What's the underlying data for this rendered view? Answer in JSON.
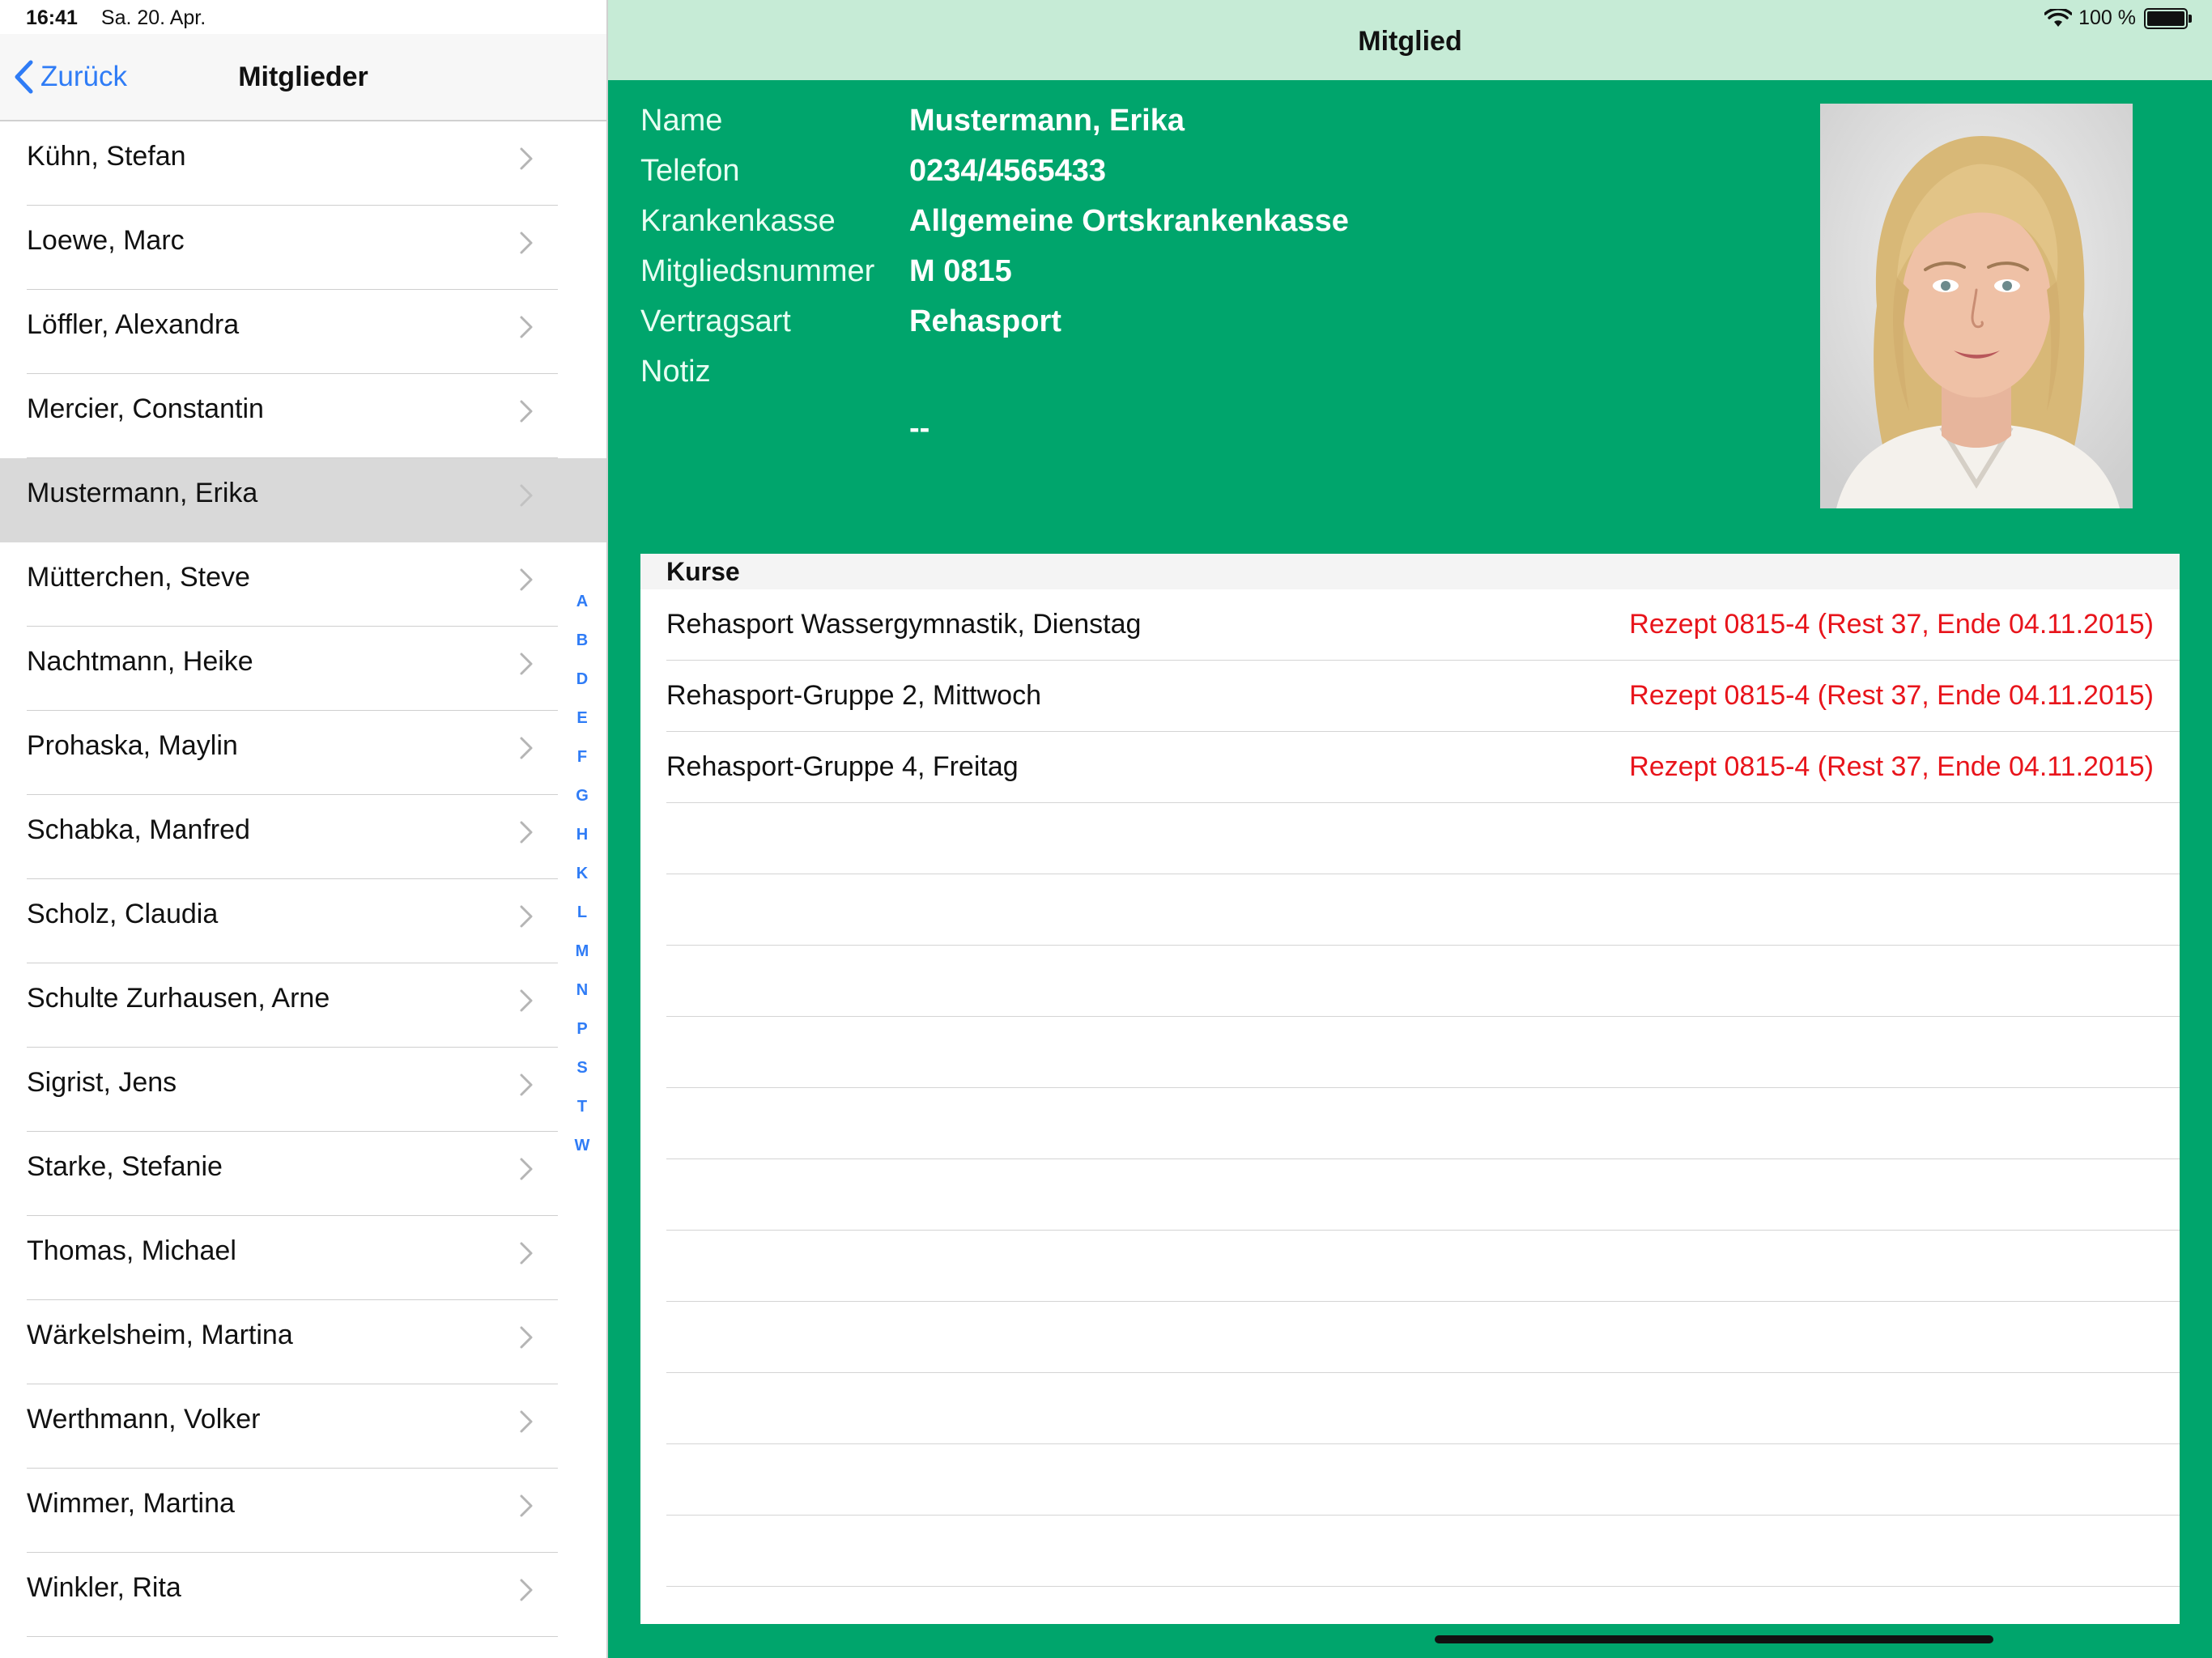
{
  "status": {
    "time": "16:41",
    "date": "Sa. 20. Apr.",
    "battery": "100 %",
    "wifi_icon": "wifi-icon",
    "battery_icon": "battery-icon"
  },
  "left_nav": {
    "back_label": "Zurück",
    "title": "Mitglieder"
  },
  "members": [
    {
      "name": "Kühn, Stefan"
    },
    {
      "name": "Loewe, Marc"
    },
    {
      "name": "Löffler, Alexandra"
    },
    {
      "name": "Mercier, Constantin"
    },
    {
      "name": "Mustermann, Erika",
      "selected": true
    },
    {
      "name": "Mütterchen, Steve"
    },
    {
      "name": "Nachtmann, Heike"
    },
    {
      "name": "Prohaska, Maylin"
    },
    {
      "name": "Schabka, Manfred"
    },
    {
      "name": "Scholz, Claudia"
    },
    {
      "name": "Schulte Zurhausen, Arne"
    },
    {
      "name": "Sigrist, Jens"
    },
    {
      "name": "Starke, Stefanie"
    },
    {
      "name": "Thomas, Michael"
    },
    {
      "name": "Wärkelsheim, Martina"
    },
    {
      "name": "Werthmann, Volker"
    },
    {
      "name": "Wimmer, Martina"
    },
    {
      "name": "Winkler, Rita"
    }
  ],
  "index_letters": [
    "A",
    "B",
    "D",
    "E",
    "F",
    "G",
    "H",
    "K",
    "L",
    "M",
    "N",
    "P",
    "S",
    "T",
    "W"
  ],
  "detail": {
    "title": "Mitglied",
    "fields": {
      "name_label": "Name",
      "name_value": "Mustermann, Erika",
      "phone_label": "Telefon",
      "phone_value": "0234/4565433",
      "insurance_label": "Krankenkasse",
      "insurance_value": "Allgemeine Ortskrankenkasse",
      "member_no_label": "Mitgliedsnummer",
      "member_no_value": "M 0815",
      "contract_label": "Vertragsart",
      "contract_value": "Rehasport",
      "note_label": "Notiz",
      "note_value": "--"
    },
    "courses_header": "Kurse",
    "courses": [
      {
        "name": "Rehasport Wassergymnastik, Dienstag",
        "prescription": "Rezept 0815-4 (Rest 37, Ende 04.11.2015)"
      },
      {
        "name": "Rehasport-Gruppe 2, Mittwoch",
        "prescription": "Rezept 0815-4 (Rest 37, Ende 04.11.2015)"
      },
      {
        "name": "Rehasport-Gruppe 4, Freitag",
        "prescription": "Rezept 0815-4 (Rest 37, Ende 04.11.2015)"
      }
    ]
  },
  "colors": {
    "accent": "#00a56c",
    "nav_tint": "#c6ebd6",
    "link": "#2f7cf6",
    "prescription": "#e8141b"
  }
}
